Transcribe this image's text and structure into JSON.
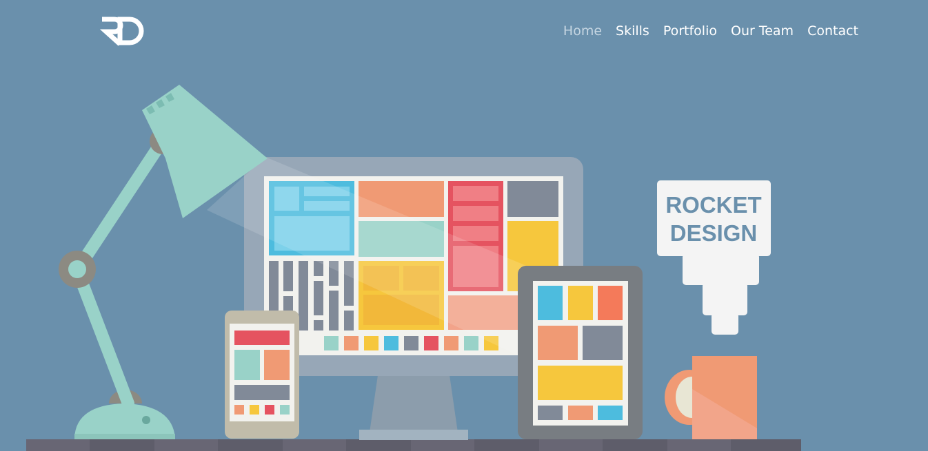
{
  "brand": {
    "logo_text": "RD"
  },
  "nav": {
    "items": [
      {
        "label": "Home",
        "active": true
      },
      {
        "label": "Skills",
        "active": false
      },
      {
        "label": "Portfolio",
        "active": false
      },
      {
        "label": "Our Team",
        "active": false
      },
      {
        "label": "Contact",
        "active": false
      }
    ]
  },
  "hero": {
    "sign_line1": "ROCKET",
    "sign_line2": "DESIGN"
  },
  "colors": {
    "background": "#6a90ac",
    "nav_text": "#ffffff",
    "nav_active": "#c6d6e2",
    "lamp": "#99d2c8",
    "mug": "#f09a74",
    "desk": "#5e5d6a"
  },
  "icons": [
    "rd-logo-icon",
    "desk-lamp-icon",
    "desktop-monitor-icon",
    "tablet-icon",
    "phone-icon",
    "rocket-sign-icon",
    "coffee-mug-icon"
  ]
}
